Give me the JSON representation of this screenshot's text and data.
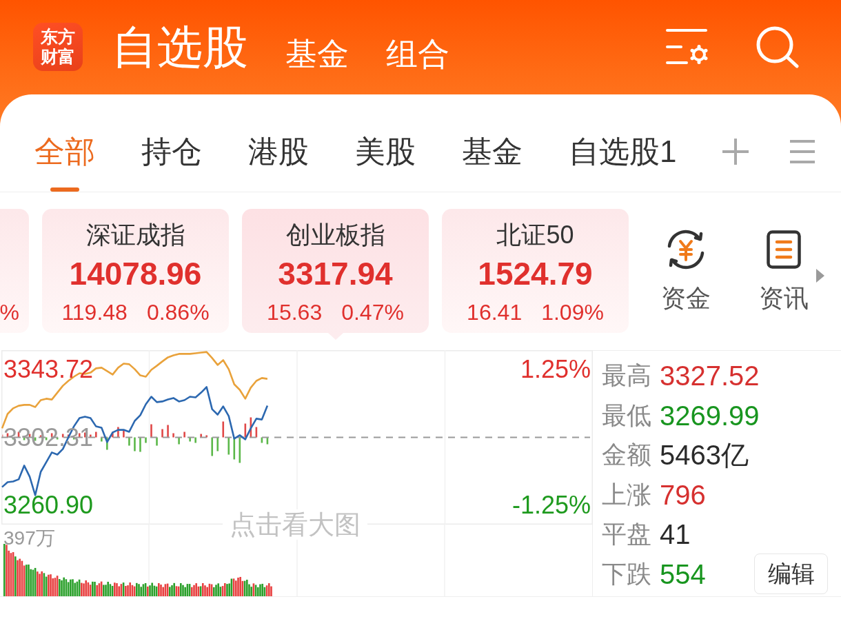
{
  "logo": {
    "lines": [
      "东方",
      "财富"
    ]
  },
  "header_tabs": [
    {
      "label": "自选股",
      "selected": true
    },
    {
      "label": "基金",
      "selected": false
    },
    {
      "label": "组合",
      "selected": false
    }
  ],
  "tabs": [
    {
      "label": "全部",
      "selected": true
    },
    {
      "label": "持仓",
      "selected": false
    },
    {
      "label": "港股",
      "selected": false
    },
    {
      "label": "美股",
      "selected": false
    },
    {
      "label": "基金",
      "selected": false
    },
    {
      "label": "自选股1",
      "selected": false
    }
  ],
  "index_cards": [
    {
      "change_pct": "%",
      "up": true,
      "selected": false
    },
    {
      "name": "深证成指",
      "value": "14078.96",
      "change": "119.48",
      "change_pct": "0.86%",
      "up": true,
      "selected": false
    },
    {
      "name": "创业板指",
      "value": "3317.94",
      "change": "15.63",
      "change_pct": "0.47%",
      "up": true,
      "selected": true
    },
    {
      "name": "北证50",
      "value": "1524.79",
      "change": "16.41",
      "change_pct": "1.09%",
      "up": true,
      "selected": false
    }
  ],
  "shortcuts": [
    {
      "label": "资金"
    },
    {
      "label": "资讯"
    }
  ],
  "chart": {
    "chart_data": [
      {
        "type": "line",
        "categories": [
          null,
          null,
          null,
          null,
          null,
          null,
          null,
          null,
          null,
          null,
          null,
          null,
          null,
          null,
          null,
          null,
          null,
          null,
          null,
          null,
          null,
          null,
          null,
          null,
          null,
          null,
          null,
          null,
          null,
          null,
          null,
          null,
          null,
          null,
          null,
          null,
          null,
          null,
          null,
          null,
          null,
          null,
          null,
          null,
          null,
          null,
          null,
          null,
          null,
          null,
          null,
          null,
          null,
          null,
          null,
          null,
          null,
          null,
          null,
          null,
          null,
          null,
          null,
          null,
          null,
          null,
          null,
          null,
          null,
          null,
          null,
          null,
          null,
          null,
          null,
          null,
          null,
          null,
          null,
          null,
          null,
          null,
          null,
          null,
          null,
          null,
          null,
          null,
          null,
          null,
          null,
          null,
          null,
          null,
          null,
          null,
          null,
          null,
          null,
          null,
          null,
          null,
          null,
          null,
          null,
          null,
          null
        ],
        "ylim": [
          3249.13,
          3355.49
        ],
        "yticks": [
          {
            "value": 3343.72,
            "label": "3343.72"
          },
          {
            "value": 3302.31,
            "label": "3302.31"
          },
          {
            "value": 3260.9,
            "label": "3260.90"
          }
        ],
        "y2lim": [
          -1.605,
          1.605
        ],
        "y2ticks": [
          {
            "value": 1.25,
            "label": "1.25%"
          },
          {
            "value": -1.25,
            "label": "-1.25%"
          }
        ],
        "grid": true,
        "ref_lines": [
          {
            "axis": "y",
            "value": 3302.31,
            "color": "#9a9a9a",
            "line_style": "dashed"
          }
        ],
        "series": [
          {
            "color": "#e9a23b",
            "values": [
              3307.8,
              3316.6,
              3320.0,
              3321.6,
              3322.1,
              3322.1,
              3320.8,
              3325.0,
              3325.9,
              3325.4,
              3329.6,
              3333.8,
              3336.8,
              3339.3,
              3341.4,
              3341.0,
              3341.8,
              3344.4,
              3344.8,
              3342.7,
              3340.6,
              3344.8,
              3347.3,
              3346.9,
              3343.9,
              3340.1,
              3339.3,
              3343.5,
              3346.0,
              3348.6,
              3351.1,
              3352.3,
              3353.2,
              3353.2,
              3353.2,
              3353.6,
              3354.0,
              3354.4,
              3350.7,
              3346.5,
              3349.4,
              3343.9,
              3334.7,
              3331.3,
              3325.9,
              3332.6,
              3336.8,
              3338.5,
              3338.0,
              null,
              null,
              null,
              null,
              null,
              null,
              null,
              null,
              null,
              null,
              null,
              null,
              null,
              null,
              null,
              null,
              null,
              null,
              null,
              null,
              null,
              null,
              null,
              null,
              null,
              null,
              null,
              null,
              null,
              null,
              null,
              null,
              null,
              null,
              null,
              null,
              null,
              null,
              null,
              null,
              null,
              null,
              null,
              null,
              null,
              null,
              null,
              null,
              null,
              null,
              null,
              null,
              null,
              null,
              null,
              null,
              null,
              null
            ]
          },
          {
            "color": "#2c68b0",
            "values": [
              3272.0,
              3275.0,
              3275.4,
              3276.7,
              3285.1,
              3278.3,
              3267.0,
              3281.3,
              3287.2,
              3293.1,
              3291.8,
              3295.2,
              3302.3,
              3309.0,
              3314.1,
              3314.9,
              3314.1,
              3309.0,
              3308.2,
              3299.4,
              3305.3,
              3306.9,
              3306.9,
              3305.7,
              3312.4,
              3315.8,
              3322.5,
              3327.1,
              3323.8,
              3324.2,
              3325.4,
              3326.3,
              3324.2,
              3325.0,
              3327.1,
              3326.7,
              3329.6,
              3333.0,
              3319.5,
              3316.2,
              3321.2,
              3315.3,
              3301.5,
              3303.6,
              3301.1,
              3307.8,
              3313.7,
              3313.2,
              3321.6,
              null,
              null,
              null,
              null,
              null,
              null,
              null,
              null,
              null,
              null,
              null,
              null,
              null,
              null,
              null,
              null,
              null,
              null,
              null,
              null,
              null,
              null,
              null,
              null,
              null,
              null,
              null,
              null,
              null,
              null,
              null,
              null,
              null,
              null,
              null,
              null,
              null,
              null,
              null,
              null,
              null,
              null,
              null,
              null,
              null,
              null,
              null,
              null,
              null,
              null,
              null,
              null,
              null,
              null,
              null,
              null,
              null,
              null
            ]
          }
        ]
      }
    ],
    "hint": "点击看大图",
    "volume_label": "397万"
  },
  "stats": [
    {
      "label": "最高",
      "value": "3327.52",
      "color": "#d6302f"
    },
    {
      "label": "最低",
      "value": "3269.99",
      "color": "#18951f"
    },
    {
      "label": "金额",
      "value": "5463亿",
      "color": "#2b2b2b"
    },
    {
      "label": "上涨",
      "value": "796",
      "color": "#d6302f"
    },
    {
      "label": "平盘",
      "value": "41",
      "color": "#2b2b2b"
    },
    {
      "label": "下跌",
      "value": "554",
      "color": "#18951f"
    }
  ],
  "edit_button": "编辑"
}
